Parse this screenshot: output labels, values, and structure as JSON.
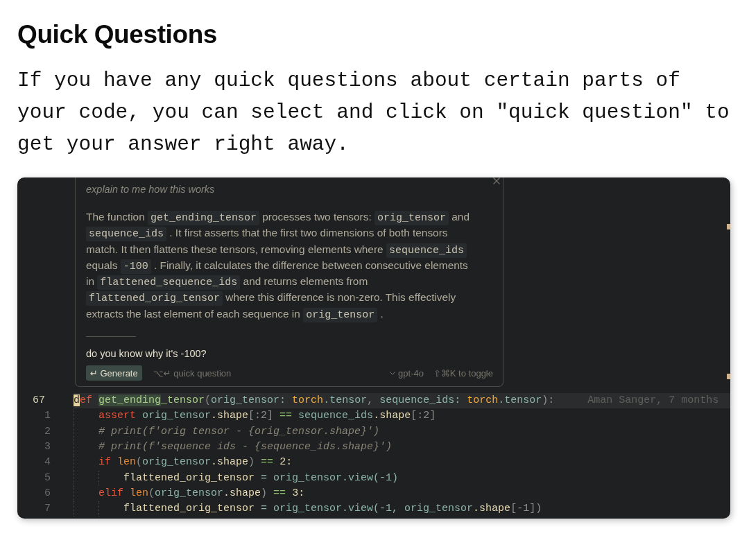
{
  "heading": "Quick Questions",
  "intro": "If you have any quick questions about certain parts of your code, you can select and click on \"quick question\" to get your answer right away.",
  "editor": {
    "chat_panel": {
      "prompt": "explain to me how this works",
      "answer": [
        {
          "kind": "text",
          "text": "The function "
        },
        {
          "kind": "code",
          "text": "get_ending_tensor"
        },
        {
          "kind": "text",
          "text": " processes two tensors: "
        },
        {
          "kind": "code",
          "text": "orig_tensor"
        },
        {
          "kind": "text",
          "text": " and "
        },
        {
          "kind": "code",
          "text": "sequence_ids"
        },
        {
          "kind": "text",
          "text": " . It first asserts that the first two dimensions of both tensors match. It then flattens these tensors, removing elements where "
        },
        {
          "kind": "code",
          "text": "sequence_ids"
        },
        {
          "kind": "text",
          "text": " equals "
        },
        {
          "kind": "code",
          "text": "-100"
        },
        {
          "kind": "text",
          "text": " . Finally, it calculates the difference between consecutive elements in "
        },
        {
          "kind": "code",
          "text": "flattened_sequence_ids"
        },
        {
          "kind": "text",
          "text": " and returns elements from "
        },
        {
          "kind": "code",
          "text": "flattened_orig_tensor"
        },
        {
          "kind": "text",
          "text": " where this difference is non-zero. This effectively extracts the last element of each sequence in "
        },
        {
          "kind": "code",
          "text": "orig_tensor"
        },
        {
          "kind": "text",
          "text": " ."
        }
      ],
      "follow_up": "do you know why it's -100?",
      "generate_button": "↵ Generate",
      "shortcut_hint": "⌥↵ quick question",
      "model": "gpt-4o",
      "toggle_hint": "⇧⌘K to toggle"
    },
    "lines": [
      {
        "number": "67",
        "current": true,
        "tokens": [
          {
            "kind": "cursor",
            "text": "d"
          },
          {
            "kind": "keyword",
            "text": "ef "
          },
          {
            "kind": "selection",
            "text": "get_ending"
          },
          {
            "kind": "function",
            "text": "_tensor"
          },
          {
            "kind": "punct",
            "text": "("
          },
          {
            "kind": "param",
            "text": "orig_tensor: "
          },
          {
            "kind": "type",
            "text": "torch"
          },
          {
            "kind": "param",
            "text": ".tensor"
          },
          {
            "kind": "punct",
            "text": ", "
          },
          {
            "kind": "param",
            "text": "sequence_ids: "
          },
          {
            "kind": "type",
            "text": "torch"
          },
          {
            "kind": "param",
            "text": ".tensor"
          },
          {
            "kind": "punct",
            "text": "):"
          }
        ],
        "blame": "Aman Sanger, 7 months",
        "children": [
          {
            "number": "1",
            "current": false,
            "tokens": [
              {
                "kind": "keyword",
                "text": "assert "
              },
              {
                "kind": "param",
                "text": "orig_tensor"
              },
              {
                "kind": "variable",
                "text": ".shape"
              },
              {
                "kind": "punct",
                "text": "[:2] "
              },
              {
                "kind": "operator",
                "text": "== "
              },
              {
                "kind": "param",
                "text": "sequence_ids"
              },
              {
                "kind": "variable",
                "text": ".shape"
              },
              {
                "kind": "punct",
                "text": "[:2]"
              }
            ]
          },
          {
            "number": "2",
            "current": false,
            "tokens": [
              {
                "kind": "comment",
                "text": "# print(f'orig tensor - {orig_tensor.shape}')"
              }
            ]
          },
          {
            "number": "3",
            "current": false,
            "tokens": [
              {
                "kind": "comment",
                "text": "# print(f'sequence ids - {sequence_ids.shape}')"
              }
            ]
          },
          {
            "number": "4",
            "current": false,
            "tokens": [
              {
                "kind": "keyword",
                "text": "if "
              },
              {
                "kind": "builtin",
                "text": "len"
              },
              {
                "kind": "punct",
                "text": "("
              },
              {
                "kind": "param",
                "text": "orig_tensor"
              },
              {
                "kind": "variable",
                "text": ".shape"
              },
              {
                "kind": "punct",
                "text": ") "
              },
              {
                "kind": "operator",
                "text": "== "
              },
              {
                "kind": "number",
                "text": "2:"
              }
            ],
            "children": [
              {
                "number": "5",
                "current": false,
                "tokens": [
                  {
                    "kind": "variable",
                    "text": "flattened_orig_tensor "
                  },
                  {
                    "kind": "param",
                    "text": "= orig_tensor.view(-1)"
                  }
                ]
              }
            ]
          },
          {
            "number": "6",
            "current": false,
            "tokens": [
              {
                "kind": "keyword",
                "text": "elif "
              },
              {
                "kind": "builtin",
                "text": "len"
              },
              {
                "kind": "punct",
                "text": "("
              },
              {
                "kind": "param",
                "text": "orig_tensor"
              },
              {
                "kind": "variable",
                "text": ".shape"
              },
              {
                "kind": "punct",
                "text": ") "
              },
              {
                "kind": "operator",
                "text": "== "
              },
              {
                "kind": "number",
                "text": "3:"
              }
            ],
            "children": [
              {
                "number": "7",
                "current": false,
                "tokens": [
                  {
                    "kind": "variable",
                    "text": "flattened_orig_tensor "
                  },
                  {
                    "kind": "param",
                    "text": "= orig_tensor.view(-1, orig_tensor"
                  },
                  {
                    "kind": "variable",
                    "text": ".shape"
                  },
                  {
                    "kind": "punct",
                    "text": "[-1])"
                  }
                ]
              }
            ]
          }
        ]
      }
    ]
  }
}
